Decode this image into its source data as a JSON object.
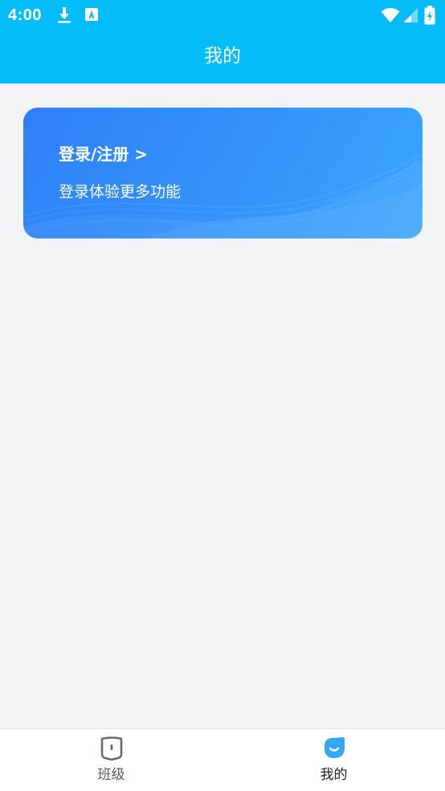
{
  "status_bar": {
    "time": "4:00",
    "icons": [
      "download-icon",
      "keyboard-a-icon",
      "wifi-icon",
      "signal-icon",
      "battery-charging-icon"
    ]
  },
  "header": {
    "title": "我的"
  },
  "login_card": {
    "title": "登录/注册 >",
    "subtitle": "登录体验更多功能"
  },
  "bottom_nav": {
    "tabs": [
      {
        "label": "班级",
        "icon": "class-book-icon",
        "active": false
      },
      {
        "label": "我的",
        "icon": "profile-smile-icon",
        "active": true
      }
    ]
  },
  "colors": {
    "header_bg": "#03bcf8",
    "page_bg": "#f2f3f5",
    "card_gradient_start": "#2f7ff6",
    "card_gradient_end": "#3ba6fb",
    "nav_active_icon": "#36a6f6",
    "nav_inactive_icon": "#666b73"
  }
}
